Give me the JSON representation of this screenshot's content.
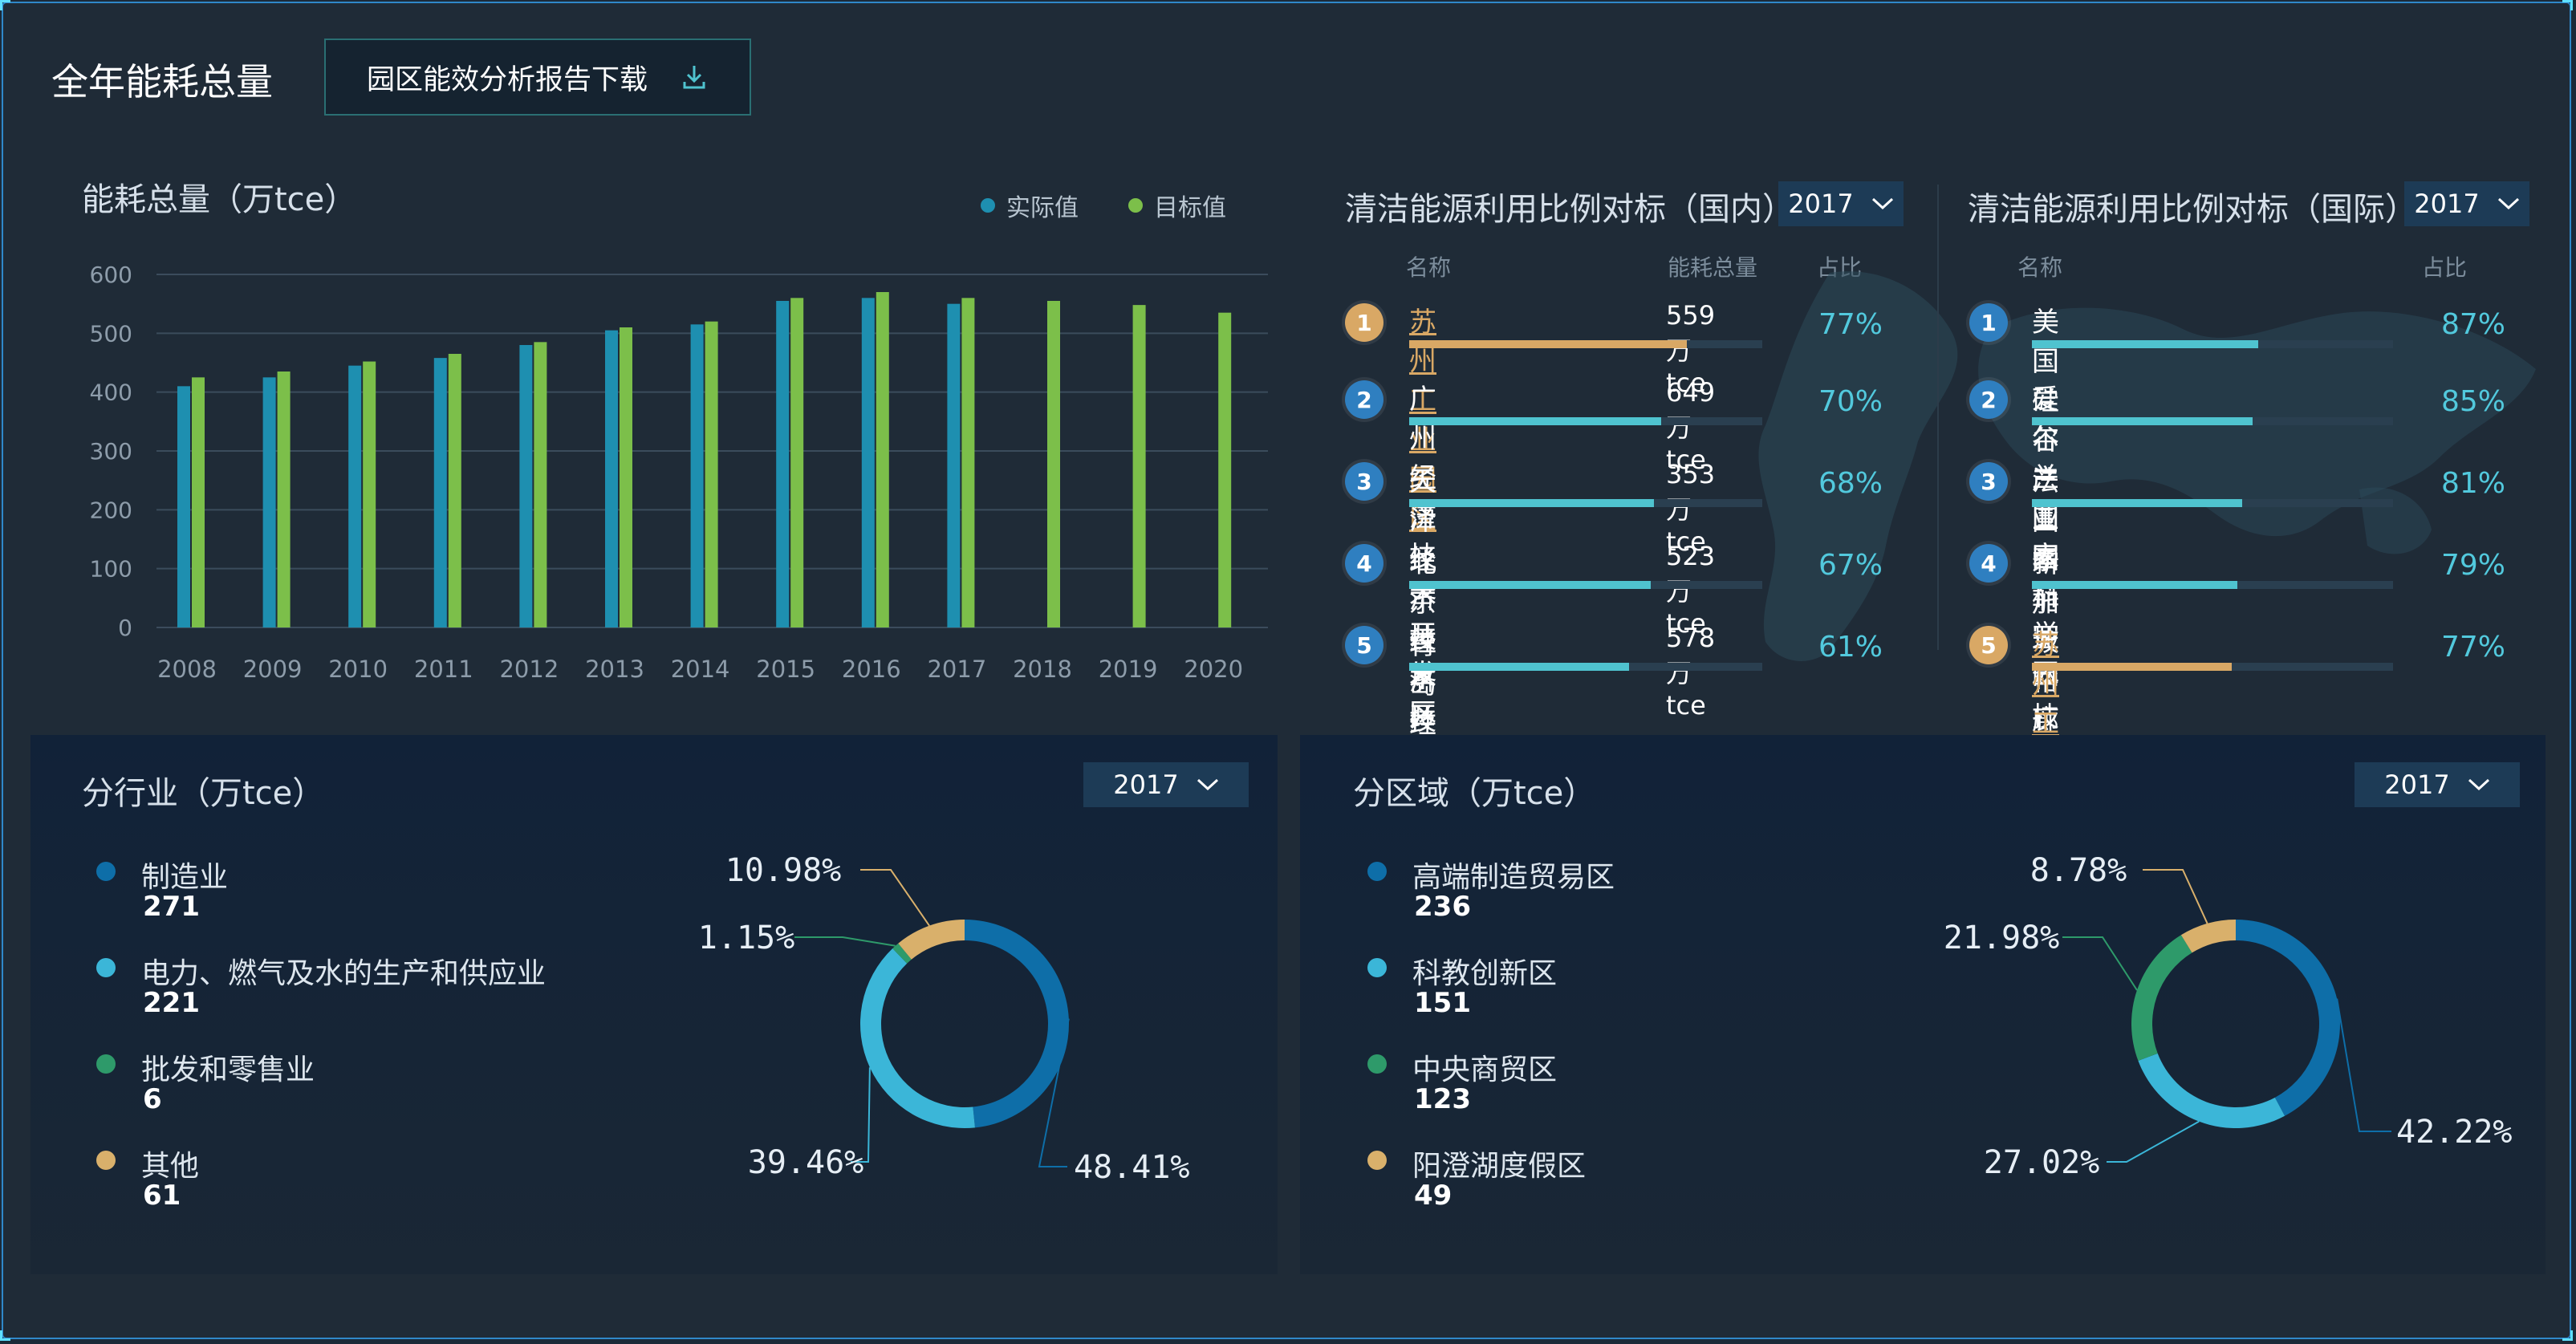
{
  "header": {
    "title": "全年能耗总量",
    "download_label": "园区能效分析报告下载"
  },
  "energy_chart": {
    "title": "能耗总量（万tce）",
    "legend": [
      "实际值",
      "目标值"
    ]
  },
  "domestic": {
    "title": "清洁能源利用比例对标（国内）",
    "year": "2017",
    "col_name": "名称",
    "col_energy": "能耗总量",
    "col_pct": "占比",
    "rows": [
      {
        "rank": "1",
        "name": "苏州工业园区",
        "energy": "559万tce",
        "pct": "77%",
        "ratio": 0.77
      },
      {
        "rank": "2",
        "name": "广州经济技术开发区",
        "energy": "649万tce",
        "pct": "70%",
        "ratio": 0.7
      },
      {
        "rank": "3",
        "name": "天津经济技术开发区",
        "energy": "353万tce",
        "pct": "68%",
        "ratio": 0.68
      },
      {
        "rank": "4",
        "name": "北京经济技术开发区",
        "energy": "523万tce",
        "pct": "67%",
        "ratio": 0.67
      },
      {
        "rank": "5",
        "name": "青岛经济技术开发区",
        "energy": "578万tce",
        "pct": "61%",
        "ratio": 0.61
      }
    ]
  },
  "international": {
    "title": "清洁能源利用比例对标（国际）",
    "year": "2017",
    "col_name": "名称",
    "col_pct": "占比",
    "rows": [
      {
        "rank": "1",
        "name": "美国硅谷产业园",
        "pct": "87%",
        "ratio": 0.87
      },
      {
        "rank": "2",
        "name": "爱尔兰国家科学园",
        "pct": "85%",
        "ratio": 0.85
      },
      {
        "rank": "3",
        "name": "法国索菲亚科技园",
        "pct": "81%",
        "ratio": 0.81
      },
      {
        "rank": "4",
        "name": "新加坡裕廊产业园",
        "pct": "79%",
        "ratio": 0.79
      },
      {
        "rank": "5",
        "name": "苏州工业园区",
        "pct": "77%",
        "ratio": 0.77
      }
    ]
  },
  "industry": {
    "title": "分行业（万tce）",
    "year": "2017",
    "items": [
      {
        "name": "制造业",
        "value": "271"
      },
      {
        "name": "电力、燃气及水的生产和供应业",
        "value": "221"
      },
      {
        "name": "批发和零售业",
        "value": "6"
      },
      {
        "name": "其他",
        "value": "61"
      }
    ]
  },
  "region": {
    "title": "分区域（万tce）",
    "year": "2017",
    "items": [
      {
        "name": "高端制造贸易区",
        "value": "236"
      },
      {
        "name": "科教创新区",
        "value": "151"
      },
      {
        "name": "中央商贸区",
        "value": "123"
      },
      {
        "name": "阳澄湖度假区",
        "value": "49"
      }
    ]
  },
  "colors": {
    "actual": "#1e8fb0",
    "target": "#7cbf4a",
    "gold": "#d9a865",
    "teal": "#4fc3cf",
    "blue": "#2f7fc0",
    "dark_blue": "#0e6ea8",
    "light_blue": "#3bb6d8",
    "green": "#2e9a6a",
    "sand": "#d9b06b"
  },
  "chart_data": [
    {
      "type": "bar",
      "categories": [
        "2008",
        "2009",
        "2010",
        "2011",
        "2012",
        "2013",
        "2014",
        "2015",
        "2016",
        "2017",
        "2018",
        "2019",
        "2020"
      ],
      "series": [
        {
          "name": "实际值",
          "values": [
            410,
            425,
            445,
            458,
            480,
            505,
            515,
            555,
            560,
            550,
            null,
            null,
            null
          ]
        },
        {
          "name": "目标值",
          "values": [
            425,
            435,
            452,
            465,
            485,
            510,
            520,
            560,
            570,
            560,
            555,
            548,
            535
          ]
        }
      ],
      "ylim": [
        0,
        600
      ],
      "yticks": [
        0,
        100,
        200,
        300,
        400,
        500,
        600
      ],
      "legend": "top-right",
      "grid": true
    },
    {
      "type": "pie",
      "labels": [
        "制造业",
        "电力、燃气及水的生产和供应业",
        "批发和零售业",
        "其他"
      ],
      "values": [
        48.41,
        39.46,
        1.15,
        10.98
      ],
      "value_labels": [
        "48.41%",
        "39.46%",
        "1.15%",
        "10.98%"
      ]
    },
    {
      "type": "pie",
      "labels": [
        "高端制造贸易区",
        "科教创新区",
        "中央商贸区",
        "阳澄湖度假区"
      ],
      "values": [
        42.22,
        27.02,
        21.98,
        8.78
      ],
      "value_labels": [
        "42.22%",
        "27.02%",
        "21.98%",
        "8.78%"
      ]
    }
  ]
}
